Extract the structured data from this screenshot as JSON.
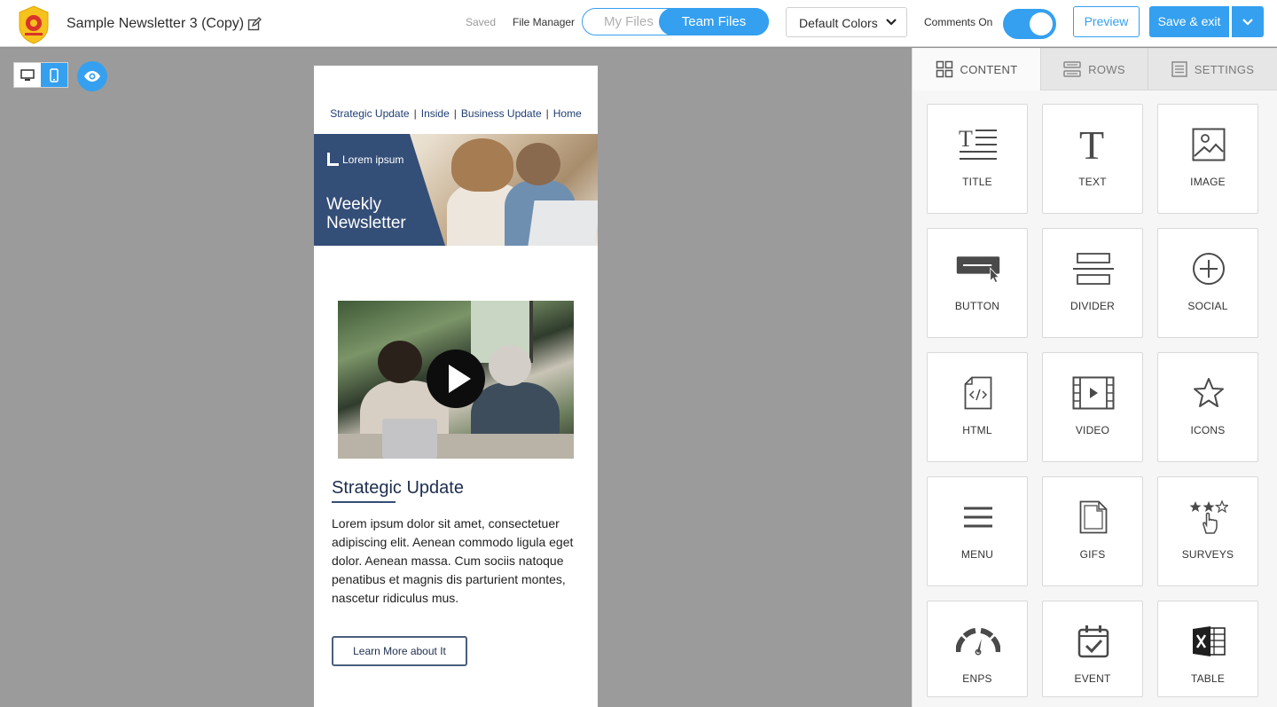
{
  "header": {
    "doc_title": "Sample Newsletter 3 (Copy)",
    "saved": "Saved",
    "file_manager": "File Manager",
    "segment": [
      "My Files",
      "Team Files"
    ],
    "colors_dropdown": "Default Colors",
    "comments": "Comments On",
    "preview": "Preview",
    "save_exit": "Save & exit",
    "accent": "#35a0f0"
  },
  "email": {
    "nav": [
      "Strategic Update",
      "Inside",
      "Business Update",
      "Home"
    ],
    "brand": "Lorem ipsum",
    "hero_title_1": "Weekly",
    "hero_title_2": "Newsletter",
    "article_title": "Strategic Update",
    "article_body": "Lorem ipsum dolor sit amet, consectetuer adipiscing elit. Aenean commodo ligula eget dolor. Aenean massa. Cum sociis natoque penatibus et magnis dis parturient montes, nascetur ridiculus mus.",
    "cta": "Learn More about It",
    "hero_color": "#334e77"
  },
  "panel": {
    "tabs": [
      "CONTENT",
      "ROWS",
      "SETTINGS"
    ],
    "tiles": [
      "TITLE",
      "TEXT",
      "IMAGE",
      "BUTTON",
      "DIVIDER",
      "SOCIAL",
      "HTML",
      "VIDEO",
      "ICONS",
      "MENU",
      "GIFS",
      "SURVEYS",
      "ENPS",
      "EVENT",
      "TABLE"
    ]
  }
}
